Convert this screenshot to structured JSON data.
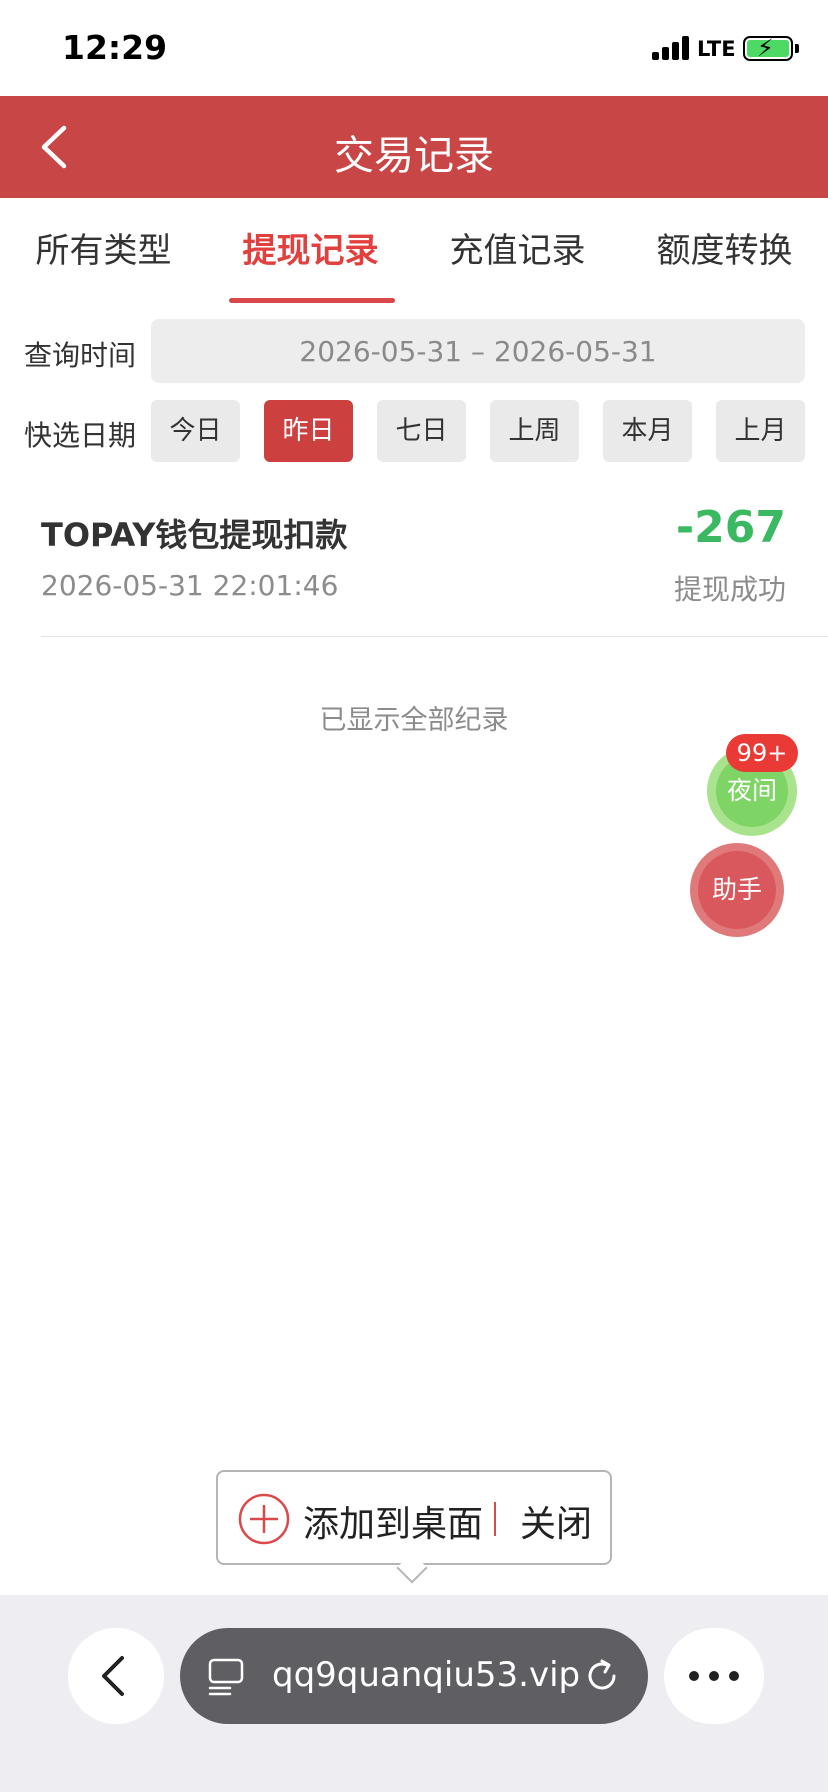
{
  "status_bar": {
    "time": "12:29",
    "network": "LTE"
  },
  "header": {
    "title": "交易记录"
  },
  "tabs": [
    {
      "label": "所有类型",
      "active": false
    },
    {
      "label": "提现记录",
      "active": true
    },
    {
      "label": "充值记录",
      "active": false
    },
    {
      "label": "额度转换",
      "active": false
    }
  ],
  "filters": {
    "query_label": "查询时间",
    "range": "2026-05-31 – 2026-05-31",
    "quick_label": "快选日期",
    "quick_options": [
      "今日",
      "昨日",
      "七日",
      "上周",
      "本月",
      "上月"
    ],
    "quick_selected": "昨日"
  },
  "records": [
    {
      "title": "TOPAY钱包提现扣款",
      "time": "2026-05-31 22:01:46",
      "amount": "-267",
      "status": "提现成功"
    }
  ],
  "list_end_text": "已显示全部纪录",
  "floating": {
    "night_label": "夜间",
    "night_badge": "99+",
    "helper_label": "助手"
  },
  "add_to_home": {
    "add_label": "添加到桌面",
    "close_label": "关闭"
  },
  "browser": {
    "url": "qq9quanqiu53.vip"
  },
  "colors": {
    "brand": "#c94646",
    "active_tab": "#e2403e",
    "amount_green": "#3bb862",
    "badge": "#e93a36"
  }
}
